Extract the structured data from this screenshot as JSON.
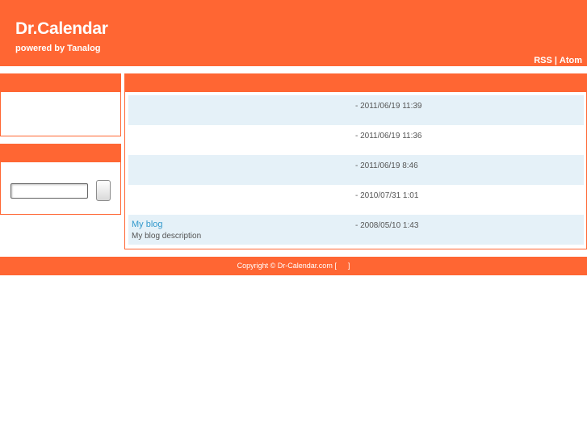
{
  "header": {
    "title": "Dr.Calendar",
    "tagline": "powered by Tanalog",
    "feeds": {
      "rss": "RSS",
      "separator": "|",
      "atom": "Atom"
    }
  },
  "sidebar": {
    "search": {
      "input_value": ""
    }
  },
  "entries": [
    {
      "title": "",
      "date": "- 2011/06/19 11:39",
      "description": ""
    },
    {
      "title": "",
      "date": "- 2011/06/19 11:36",
      "description": ""
    },
    {
      "title": "",
      "date": "- 2011/06/19 8:46",
      "description": ""
    },
    {
      "title": "",
      "date": "- 2010/07/31 1:01",
      "description": ""
    },
    {
      "title": "My blog",
      "date": "- 2008/05/10 1:43",
      "description": "My blog description"
    }
  ],
  "footer": {
    "copyright": "Copyright © Dr-Calendar.com [",
    "close_bracket": "]"
  },
  "colors": {
    "accent": "#ff6633",
    "row_alt": "#e5f1f8",
    "link": "#3399cc"
  }
}
